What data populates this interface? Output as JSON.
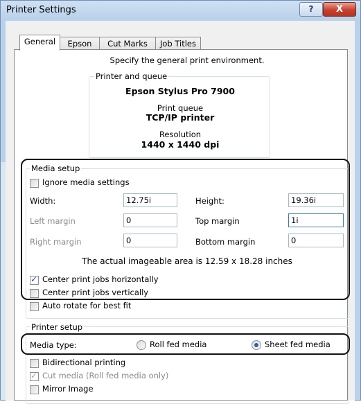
{
  "window": {
    "title": "Printer Settings",
    "help_label": "?",
    "close_label": "X"
  },
  "tabs": [
    {
      "label": "General",
      "active": true
    },
    {
      "label": "Epson",
      "active": false
    },
    {
      "label": "Cut Marks",
      "active": false
    },
    {
      "label": "Job Titles",
      "active": false
    }
  ],
  "general": {
    "description": "Specify the general print environment."
  },
  "printer_queue": {
    "legend": "Printer and queue",
    "printer_name": "Epson Stylus Pro 7900",
    "queue_label": "Print queue",
    "queue_value": "TCP/IP printer",
    "resolution_label": "Resolution",
    "resolution_value": "1440 x 1440 dpi"
  },
  "media_setup": {
    "legend": "Media setup",
    "ignore_media_label": "Ignore media settings",
    "ignore_media_checked": false,
    "width_label": "Width:",
    "width_value": "12.75i",
    "height_label": "Height:",
    "height_value": "19.36i",
    "left_margin_label": "Left margin",
    "left_margin_value": "0",
    "top_margin_label": "Top margin",
    "top_margin_value": "1i",
    "right_margin_label": "Right margin",
    "right_margin_value": "0",
    "bottom_margin_label": "Bottom margin",
    "bottom_margin_value": "0",
    "imageable_area_text": "The actual imageable area is 12.59 x 18.28 inches",
    "center_horizontal_label": "Center print jobs horizontally",
    "center_horizontal_checked": true,
    "center_vertical_label": "Center print jobs vertically",
    "center_vertical_checked": false,
    "auto_rotate_label": "Auto rotate for best fit",
    "auto_rotate_checked": false
  },
  "printer_setup": {
    "legend": "Printer setup",
    "media_type_label": "Media type:",
    "roll_fed_label": "Roll fed media",
    "roll_fed_selected": false,
    "sheet_fed_label": "Sheet fed media",
    "sheet_fed_selected": true,
    "bidirectional_label": "Bidirectional printing",
    "bidirectional_checked": false,
    "cut_media_label": "Cut media (Roll fed media only)",
    "cut_media_checked": true,
    "mirror_label": "Mirror Image",
    "mirror_checked": false
  },
  "colors": {
    "title_bar": "#b9d1ea",
    "close_button": "#c8412f",
    "checkmark": "#2a4f9f",
    "highlight_outline": "#111111"
  }
}
